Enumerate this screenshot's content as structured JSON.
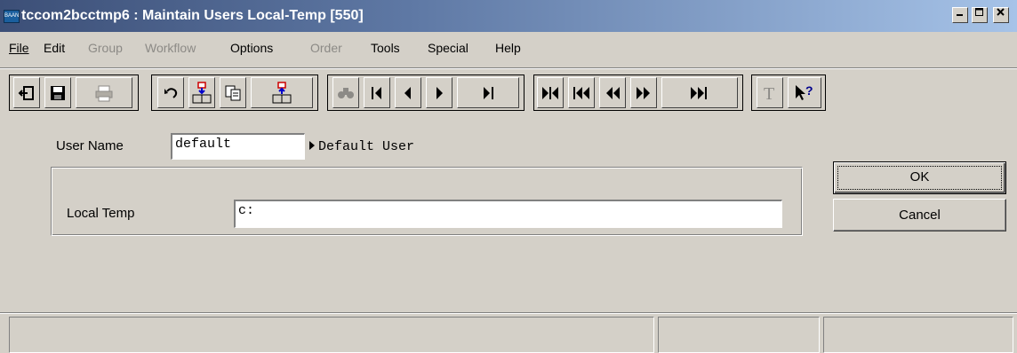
{
  "window": {
    "title": "tccom2bcctmp6 : Maintain Users Local-Temp [550]",
    "icon_text": "BAAN",
    "controls": [
      "minimize",
      "maximize",
      "close"
    ]
  },
  "menu": [
    {
      "label": "File",
      "enabled": true
    },
    {
      "label": "Edit",
      "enabled": true
    },
    {
      "label": "Group",
      "enabled": false
    },
    {
      "label": "Workflow",
      "enabled": false
    },
    {
      "label": "Options",
      "enabled": true
    },
    {
      "label": "Order",
      "enabled": false
    },
    {
      "label": "Tools",
      "enabled": true
    },
    {
      "label": "Special",
      "enabled": true
    },
    {
      "label": "Help",
      "enabled": true
    }
  ],
  "toolbar": [
    {
      "icon": "exit-icon",
      "enabled": true
    },
    {
      "icon": "save-icon",
      "enabled": true
    },
    {
      "icon": "print-icon",
      "enabled": false
    },
    {
      "icon": "undo-icon",
      "enabled": true
    },
    {
      "icon": "insert-record-icon",
      "enabled": true
    },
    {
      "icon": "copy-icon",
      "enabled": true
    },
    {
      "icon": "delete-record-icon",
      "enabled": true
    },
    {
      "icon": "find-icon",
      "enabled": false
    },
    {
      "icon": "first-record-icon",
      "enabled": true
    },
    {
      "icon": "previous-record-icon",
      "enabled": true
    },
    {
      "icon": "next-record-icon",
      "enabled": true
    },
    {
      "icon": "last-record-icon",
      "enabled": true
    },
    {
      "icon": "first-group-icon",
      "enabled": true
    },
    {
      "icon": "previous-group-icon",
      "enabled": true
    },
    {
      "icon": "previous-set-icon",
      "enabled": true
    },
    {
      "icon": "next-set-icon",
      "enabled": true
    },
    {
      "icon": "next-group-icon",
      "enabled": true
    },
    {
      "icon": "text-icon",
      "enabled": false
    },
    {
      "icon": "context-help-icon",
      "enabled": true
    }
  ],
  "form": {
    "user_name_label": "User Name",
    "user_name_value": "default",
    "user_description": "Default User",
    "local_temp_label": "Local Temp",
    "local_temp_value": "c:"
  },
  "buttons": {
    "ok": "OK",
    "cancel": "Cancel"
  },
  "status_bar": {
    "panes": [
      "",
      "",
      ""
    ]
  }
}
